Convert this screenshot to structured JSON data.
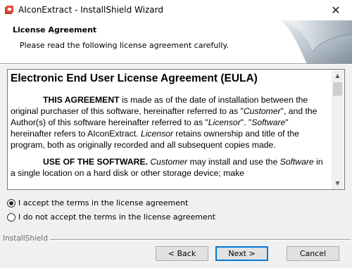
{
  "window": {
    "title": "AIconExtract - InstallShield Wizard",
    "close_glyph": "✕",
    "app_icon": "installer-icon"
  },
  "header": {
    "title": "License Agreement",
    "subtitle": "Please read the following license agreement carefully."
  },
  "eula": {
    "title": "Electronic End User License Agreement (EULA)",
    "p1_lead": "THIS AGREEMENT",
    "p1_a": " is made as of the date of installation between the original purchaser of this software, hereinafter referred to as \"",
    "p1_customer": "Customer",
    "p1_b": "\", and the Author(s) of this software hereinafter referred to as \"",
    "p1_licensor": "Licensor",
    "p1_c": "\". \"",
    "p1_software": "Software",
    "p1_d": "\" hereinafter refers to AIconExtract. ",
    "p1_licensor2": "Licensor",
    "p1_e": " retains ownership and title of the program, both as originally recorded and all subsequent copies made.",
    "p2_lead": "USE OF THE SOFTWARE.",
    "p2_customer": "Customer",
    "p2_a": " may install and use the ",
    "p2_software": "Software",
    "p2_b": " in a single location on a hard disk or other storage device; make"
  },
  "options": {
    "accept_label": "I accept the terms in the license agreement",
    "decline_label": "I do not accept the terms in the license agreement",
    "selected": "accept"
  },
  "footer": {
    "brand": "InstallShield",
    "back_label": "< Back",
    "next_label": "Next >",
    "cancel_label": "Cancel"
  }
}
